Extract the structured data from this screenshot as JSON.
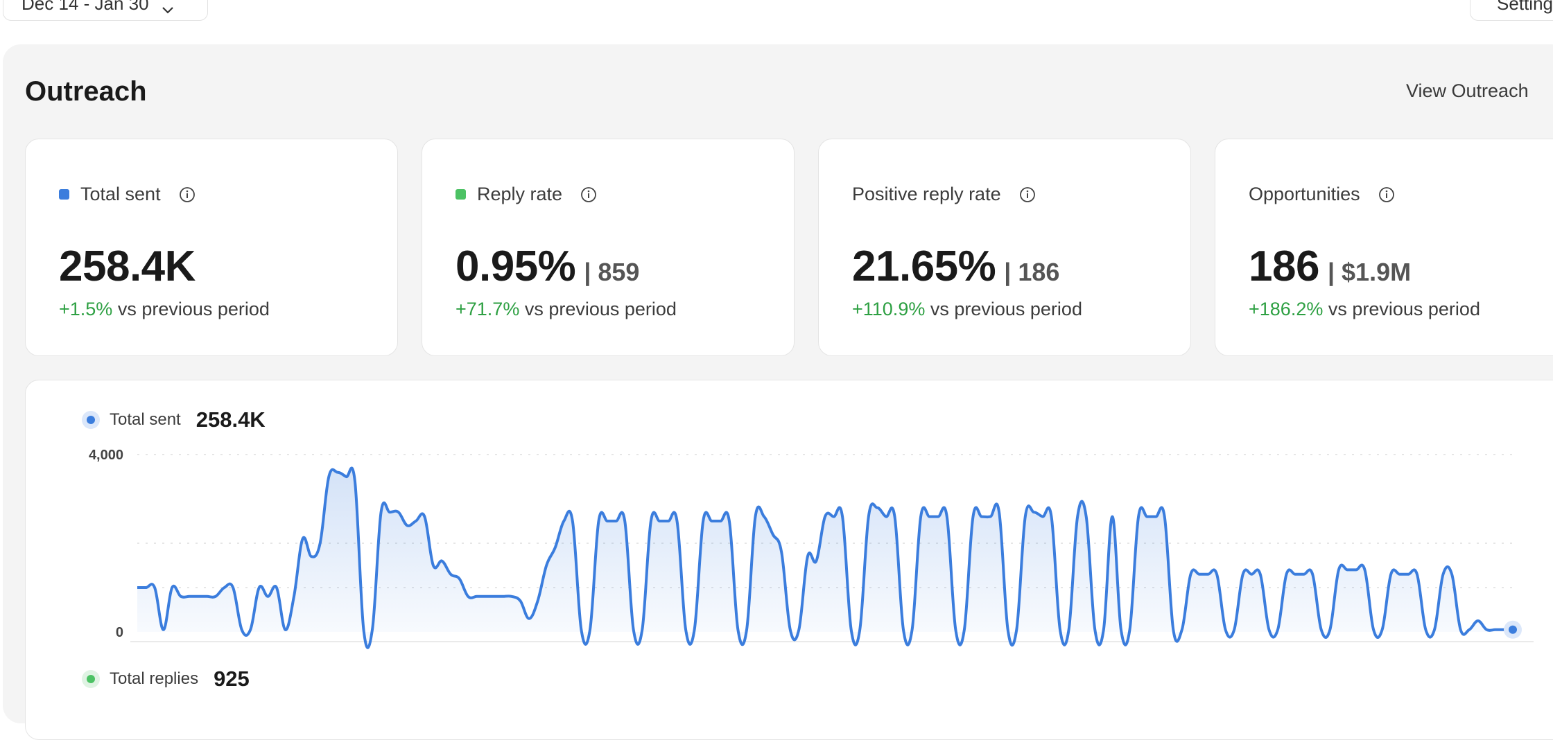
{
  "top": {
    "date_range": "Dec 14 - Jan 30",
    "settings_label": "Settings"
  },
  "section": {
    "title": "Outreach",
    "view_link": "View Outreach"
  },
  "cards": [
    {
      "label": "Total sent",
      "value": "258.4K",
      "secondary": "",
      "change": "+1.5%",
      "change_suffix": " vs previous period",
      "swatch": "#3b7ddd"
    },
    {
      "label": "Reply rate",
      "value": "0.95%",
      "secondary": "| 859",
      "change": "+71.7%",
      "change_suffix": " vs previous period",
      "swatch": "#4cc264"
    },
    {
      "label": "Positive reply rate",
      "value": "21.65%",
      "secondary": "| 186",
      "change": "+110.9%",
      "change_suffix": " vs previous period",
      "swatch": ""
    },
    {
      "label": "Opportunities",
      "value": "186",
      "secondary": "| $1.9M",
      "change": "+186.2%",
      "change_suffix": " vs previous period",
      "swatch": ""
    }
  ],
  "legend": {
    "sent_label": "Total sent",
    "sent_value": "258.4K",
    "replies_label": "Total replies",
    "replies_value": "925"
  },
  "colors": {
    "series_blue": "#3b7ddd",
    "series_green": "#4cc264",
    "positive": "#2ea043"
  },
  "chart_data": {
    "type": "area",
    "ylim": [
      0,
      4000
    ],
    "yticks": [
      "4,000",
      "0"
    ],
    "series": [
      {
        "name": "Total sent",
        "values": [
          1000,
          1000,
          1000,
          50,
          1000,
          800,
          800,
          800,
          800,
          800,
          1000,
          1000,
          50,
          50,
          1000,
          800,
          1000,
          50,
          800,
          2100,
          1700,
          2000,
          3500,
          3600,
          3500,
          3400,
          50,
          50,
          2700,
          2700,
          2700,
          2400,
          2500,
          2600,
          1500,
          1600,
          1300,
          1200,
          800,
          800,
          800,
          800,
          800,
          800,
          700,
          300,
          700,
          1500,
          1900,
          2500,
          2500,
          50,
          50,
          2500,
          2500,
          2500,
          2500,
          50,
          50,
          2500,
          2500,
          2500,
          2500,
          50,
          50,
          2500,
          2500,
          2500,
          2500,
          50,
          50,
          2600,
          2600,
          2200,
          1800,
          50,
          50,
          1700,
          1600,
          2600,
          2600,
          2600,
          50,
          50,
          2600,
          2800,
          2600,
          2600,
          50,
          50,
          2600,
          2600,
          2600,
          2600,
          50,
          50,
          2600,
          2600,
          2600,
          2700,
          50,
          50,
          2600,
          2700,
          2600,
          2600,
          50,
          50,
          2600,
          2600,
          50,
          50,
          2600,
          50,
          50,
          2600,
          2600,
          2600,
          2600,
          50,
          50,
          1300,
          1300,
          1300,
          1300,
          50,
          50,
          1300,
          1300,
          1300,
          50,
          50,
          1300,
          1300,
          1300,
          1300,
          50,
          50,
          1400,
          1400,
          1400,
          1400,
          50,
          50,
          1300,
          1300,
          1300,
          1300,
          50,
          50,
          1300,
          1300,
          50,
          50,
          250,
          50,
          50,
          50,
          50
        ]
      }
    ]
  }
}
